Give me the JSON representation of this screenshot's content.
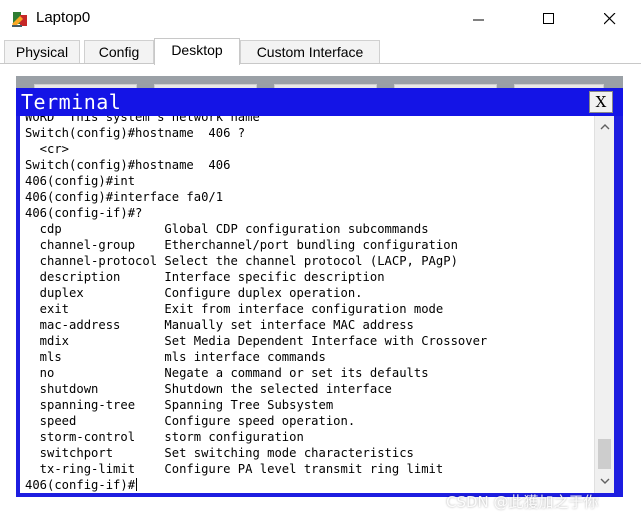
{
  "window": {
    "title": "Laptop0",
    "icon": "cisco-laptop-icon"
  },
  "tabs": [
    {
      "label": "Physical",
      "active": false
    },
    {
      "label": "Config",
      "active": false
    },
    {
      "label": "Desktop",
      "active": true
    },
    {
      "label": "Custom Interface",
      "active": false
    }
  ],
  "terminal": {
    "title": "Terminal",
    "close_label": "X",
    "lines": [
      "WORD  This system's network name",
      "Switch(config)#hostname  406 ?",
      "  <cr>",
      "Switch(config)#hostname  406",
      "406(config)#int",
      "406(config)#interface fa0/1",
      "406(config-if)#?",
      "  cdp              Global CDP configuration subcommands",
      "  channel-group    Etherchannel/port bundling configuration",
      "  channel-protocol Select the channel protocol (LACP, PAgP)",
      "  description      Interface specific description",
      "  duplex           Configure duplex operation.",
      "  exit             Exit from interface configuration mode",
      "  mac-address      Manually set interface MAC address",
      "  mdix             Set Media Dependent Interface with Crossover",
      "  mls              mls interface commands",
      "  no               Negate a command or set its defaults",
      "  shutdown         Shutdown the selected interface",
      "  spanning-tree    Spanning Tree Subsystem",
      "  speed            Configure speed operation.",
      "  storm-control    storm configuration",
      "  switchport       Set switching mode characteristics",
      "  tx-ring-limit    Configure PA level transmit ring limit"
    ],
    "prompt": "406(config-if)#"
  },
  "colors": {
    "terminal_titlebar": "#1414e6",
    "terminal_text": "#000000",
    "terminal_bg": "#ffffff"
  },
  "watermark": "CSDN @此獲加之于你"
}
